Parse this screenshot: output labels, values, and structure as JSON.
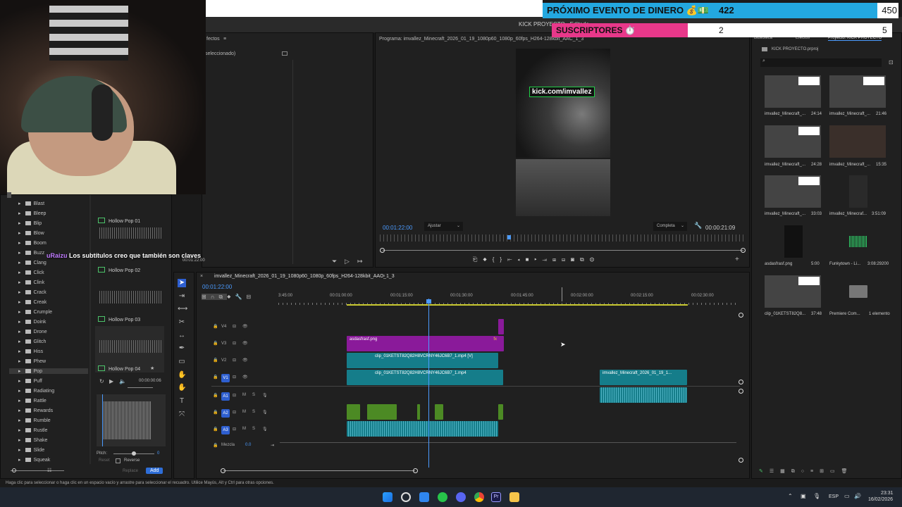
{
  "window": {
    "title": "KICK PROYECTO - Editado"
  },
  "overlay": {
    "event_label": "PRÓXIMO EVENTO DE DINERO 💰💵",
    "event_count": "422",
    "event_goal": "450",
    "subs_label": "SUSCRIPTORES ⏱️",
    "subs_count": "2",
    "subs_goal": "5"
  },
  "chat": {
    "user": "uRaizu",
    "message": "Los subtítulos creo que también son claves"
  },
  "effects_panel": {
    "title": "fectos",
    "subtitle": "seleccionado)",
    "timecode": "00:01:22:00"
  },
  "sound_library": {
    "folders": [
      "Blast",
      "Bleep",
      "Blip",
      "Blow",
      "Boom",
      "Buzz",
      "Clang",
      "Click",
      "Clink",
      "Crack",
      "Creak",
      "Crumple",
      "Doink",
      "Drone",
      "Glitch",
      "Hiss",
      "Phew",
      "Pop",
      "Puff",
      "Radiating",
      "Rattle",
      "Rewards",
      "Rumble",
      "Rustle",
      "Shake",
      "Slide",
      "Squeak"
    ],
    "selected": "Pop",
    "sounds": [
      "Hollow Pop 01",
      "Hollow Pop 02",
      "Hollow Pop 03",
      "Hollow Pop 04"
    ],
    "preview_time": "00:00:00:06",
    "pitch_label": "Pitch:",
    "pitch_value": "0",
    "reset_label": "Reset",
    "reverse_label": "Reverse",
    "replace_label": "Replace",
    "add_label": "Add"
  },
  "program_monitor": {
    "title": "Programa: imvallez_Minecraft_2026_01_19_1080p60_1080p_60fps_H264-128kbit_AAC_1_3",
    "timecode": "00:01:22:00",
    "fit": "Ajustar",
    "quality": "Completa",
    "duration": "00:00:21:09",
    "video_banner": "kick.com/imvallez"
  },
  "timeline": {
    "sequence": "imvallez_Minecraft_2026_01_19_1080p60_1080p_60fps_H264-128kbit_AAC_1_3",
    "timecode": "00:01:22:00",
    "ruler": [
      "3:45:00",
      "00:01:00:00",
      "00:01:15:00",
      "00:01:30:00",
      "00:01:45:00",
      "00:02:00:00",
      "00:02:15:00",
      "00:02:30:00"
    ],
    "tracks": [
      "V4",
      "V3",
      "V2",
      "V1",
      "A1",
      "A2",
      "A3"
    ],
    "mix_label": "Mezcla",
    "mix_value": "0.0",
    "clips": {
      "png": "asdasfrasf.png",
      "v2": "clip_01KETST82Q82H8VCRNY46JC6B7_1.mp4 [V]",
      "v1": "clip_01KETST82Q82H8VCRNY46JC6B7_1.mp4",
      "v1b": "imvallez_Minecraft_2026_01_19_1..."
    }
  },
  "project": {
    "tabs": [
      "Biblioteca",
      "Efectos",
      "Proyecto: KICK PROYECTO"
    ],
    "file": "KICK PROYECTO.prproj",
    "items": [
      {
        "name": "imvallez_Minecraft_...",
        "dur": "24:14"
      },
      {
        "name": "imvallez_Minecraft_...",
        "dur": "21:46"
      },
      {
        "name": "imvallez_Minecraft_...",
        "dur": "24:28"
      },
      {
        "name": "imvallez_Minecraft_...",
        "dur": "15:35"
      },
      {
        "name": "imvallez_Minecraft_...",
        "dur": "33:03"
      },
      {
        "name": "imvallez_Minecraf...",
        "dur": "3:51:09"
      },
      {
        "name": "asdasfrasf.png",
        "dur": "5:00"
      },
      {
        "name": "Funkytown - Li...",
        "dur": "3:08:29200"
      },
      {
        "name": "clip_01KETST82Q8...",
        "dur": "37:48"
      },
      {
        "name": "Premiere Com...",
        "dur": "1 elemento"
      }
    ]
  },
  "status_bar": "Haga clic para seleccionar o haga clic en un espacio vacío y arrastre para seleccionar el recuadro. Utilice Mayús, Alt y Ctrl para otras opciones.",
  "taskbar": {
    "lang": "ESP",
    "time": "23:31",
    "date": "16/02/2026"
  }
}
